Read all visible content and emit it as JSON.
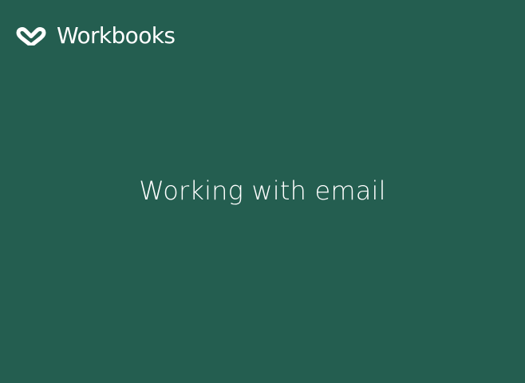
{
  "brand": {
    "name": "Workbooks",
    "logo_icon": "workbooks-infinity-heart-icon"
  },
  "slide": {
    "title": "Working with email"
  },
  "colors": {
    "background": "#245e50",
    "text": "#ffffff"
  }
}
